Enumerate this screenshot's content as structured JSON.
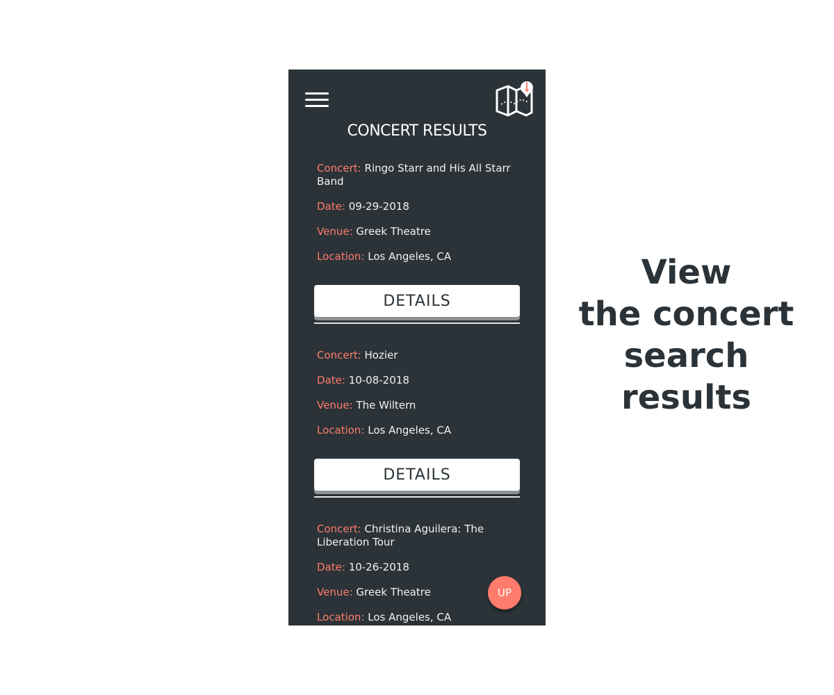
{
  "header": {
    "menu_icon": "hamburger-menu-icon",
    "logo_icon": "map-pin-logo-icon",
    "title": "CONCERT RESULTS"
  },
  "labels": {
    "concert": "Concert:",
    "date": "Date:",
    "venue": "Venue:",
    "location": "Location:"
  },
  "results": [
    {
      "concert": "Ringo Starr and His All Starr Band",
      "date": "09-29-2018",
      "venue": "Greek Theatre",
      "location": "Los Angeles, CA",
      "button_label": "DETAILS"
    },
    {
      "concert": "Hozier",
      "date": "10-08-2018",
      "venue": "The Wiltern",
      "location": "Los Angeles, CA",
      "button_label": "DETAILS"
    },
    {
      "concert": "Christina Aguilera: The Liberation Tour",
      "date": "10-26-2018",
      "venue": "Greek Theatre",
      "location": "Los Angeles, CA"
    }
  ],
  "up_button": {
    "label": "UP"
  },
  "caption": {
    "lines": [
      "View",
      "the concert",
      "search",
      "results"
    ]
  },
  "colors": {
    "background": "#2b3338",
    "accent": "#ff7b6b",
    "text": "#f2f2f2"
  }
}
